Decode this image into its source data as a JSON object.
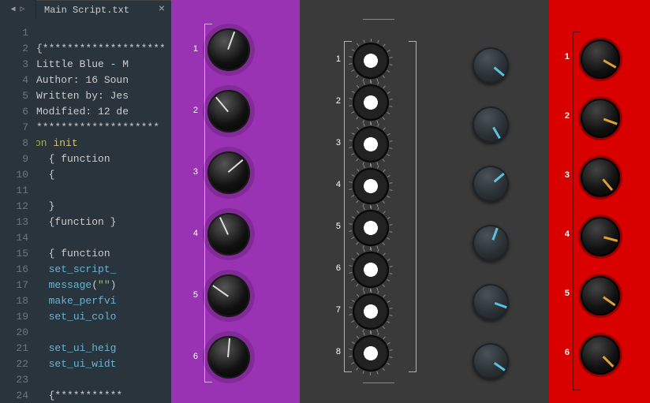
{
  "editor": {
    "tab_title": "Main Script.txt",
    "nav_back": "◀",
    "nav_fwd": "▷",
    "tab_close": "×",
    "first_line_no": 1,
    "lines": [
      "",
      "{********************",
      "Little Blue - M",
      "Author: 16 Soun",
      "Written by: Jes",
      "Modified: 12 de",
      "********************",
      "on init",
      "  { function ",
      "  {",
      "",
      "  }",
      "  {function }",
      "",
      "  { function ",
      "  set_script_",
      "  message(\"\")",
      "  make_perfvi",
      "  set_ui_colo",
      "",
      "  set_ui_heig",
      "  set_ui_widt",
      "",
      "  {***********"
    ]
  },
  "panels": {
    "purple": {
      "labels": [
        "1",
        "2",
        "3",
        "4",
        "5",
        "6"
      ],
      "angles": [
        200,
        140,
        230,
        155,
        125,
        185
      ]
    },
    "dark1": {
      "labels": [
        "1",
        "2",
        "3",
        "4",
        "5",
        "6",
        "7",
        "8"
      ]
    },
    "dark2": {
      "count": 6,
      "angles": [
        -50,
        -30,
        230,
        200,
        -70,
        -55
      ]
    },
    "red": {
      "labels": [
        "1",
        "2",
        "3",
        "4",
        "5",
        "6"
      ],
      "angles": [
        -60,
        -70,
        -40,
        -75,
        -55,
        -45
      ]
    }
  }
}
